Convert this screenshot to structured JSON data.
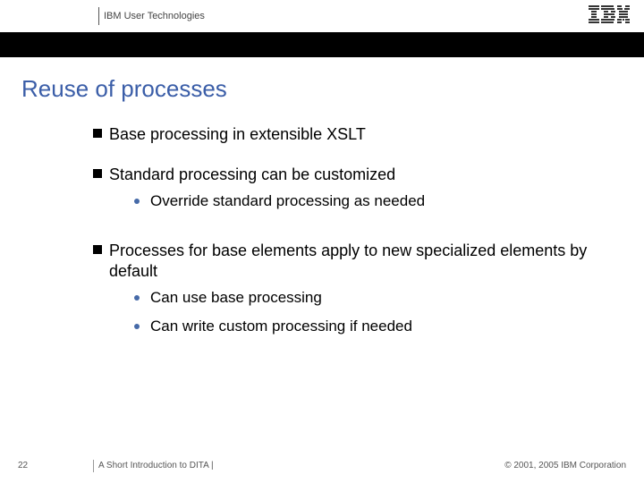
{
  "header": {
    "group": "IBM User Technologies",
    "logo_name": "ibm-logo"
  },
  "title": "Reuse of processes",
  "bullets": [
    {
      "text": "Base processing in extensible XSLT",
      "children": []
    },
    {
      "text": "Standard processing can be customized",
      "children": [
        {
          "text": "Override standard processing as needed"
        }
      ]
    },
    {
      "text": "Processes for base elements apply to new specialized elements by default",
      "children": [
        {
          "text": "Can use base processing"
        },
        {
          "text": "Can write custom processing if needed"
        }
      ]
    }
  ],
  "footer": {
    "page": "22",
    "deck": "A Short Introduction to DITA |",
    "copyright": "© 2001, 2005 IBM Corporation"
  }
}
